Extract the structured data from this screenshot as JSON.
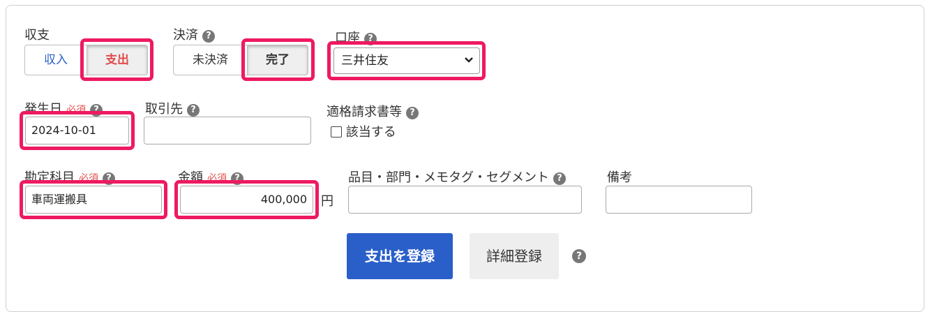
{
  "income_expense": {
    "label": "収支",
    "options": [
      "収入",
      "支出"
    ],
    "selected": "支出"
  },
  "settlement": {
    "label": "決済",
    "help": "?",
    "options": [
      "未決済",
      "完了"
    ],
    "selected": "完了"
  },
  "account": {
    "label": "口座",
    "help": "?",
    "value": "三井住友"
  },
  "date": {
    "label": "発生日",
    "required": "必須",
    "help": "?",
    "value": "2024-10-01"
  },
  "partner": {
    "label": "取引先",
    "help": "?",
    "value": ""
  },
  "invoice": {
    "label": "適格請求書等",
    "help": "?",
    "checkbox_label": "該当する"
  },
  "account_item": {
    "label": "勘定科目",
    "required": "必須",
    "help": "?",
    "value": "車両運搬具"
  },
  "amount": {
    "label": "金額",
    "required": "必須",
    "help": "?",
    "value": "400,000",
    "unit": "円"
  },
  "tags": {
    "label": "品目・部門・メモタグ・セグメント",
    "help": "?",
    "value": ""
  },
  "note": {
    "label": "備考",
    "value": ""
  },
  "actions": {
    "register_label": "支出を登録",
    "detail_label": "詳細登録",
    "help": "?"
  },
  "colors": {
    "primary": "#2a5fc9",
    "highlight": "#ee1a60",
    "required": "#e24b4b",
    "income_text": "#2a5fc9",
    "expense_text": "#e24b4b"
  }
}
